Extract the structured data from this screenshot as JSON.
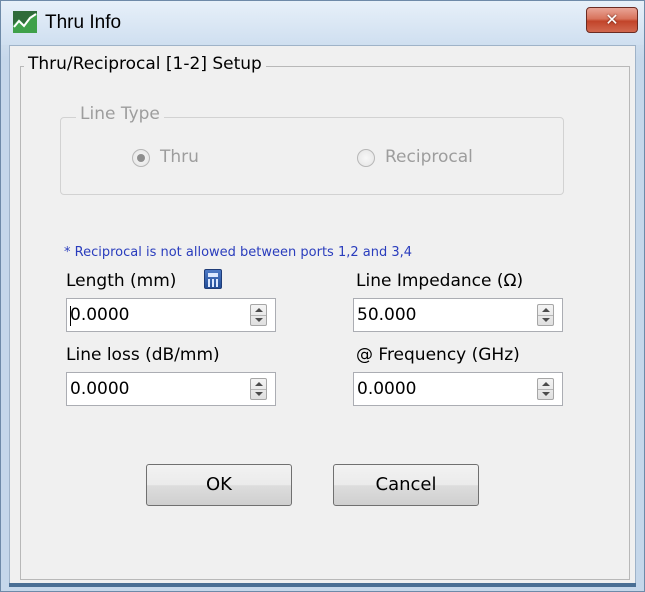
{
  "window": {
    "title": "Thru Info",
    "close_glyph": "✕",
    "icon": "app-chart-icon"
  },
  "setup_group": {
    "label": "Thru/Reciprocal [1-2] Setup"
  },
  "line_type": {
    "label": "Line Type",
    "options": [
      {
        "label": "Thru",
        "selected": true,
        "enabled": false
      },
      {
        "label": "Reciprocal",
        "selected": false,
        "enabled": false
      }
    ]
  },
  "note": "* Reciprocal is not allowed between ports 1,2 and 3,4",
  "fields": {
    "length": {
      "label": "Length (mm)",
      "value": "0.0000",
      "icon": "calculator-icon"
    },
    "line_impedance": {
      "label": "Line Impedance (Ω)",
      "value": "50.000"
    },
    "line_loss": {
      "label": "Line loss (dB/mm)",
      "value": "0.0000"
    },
    "frequency": {
      "label": "@ Frequency (GHz)",
      "value": "0.0000"
    }
  },
  "buttons": {
    "ok": "OK",
    "cancel": "Cancel"
  },
  "colors": {
    "note_text": "#2a3dbd",
    "disabled_text": "#9d9d9d",
    "close_button": "#c2442a"
  }
}
